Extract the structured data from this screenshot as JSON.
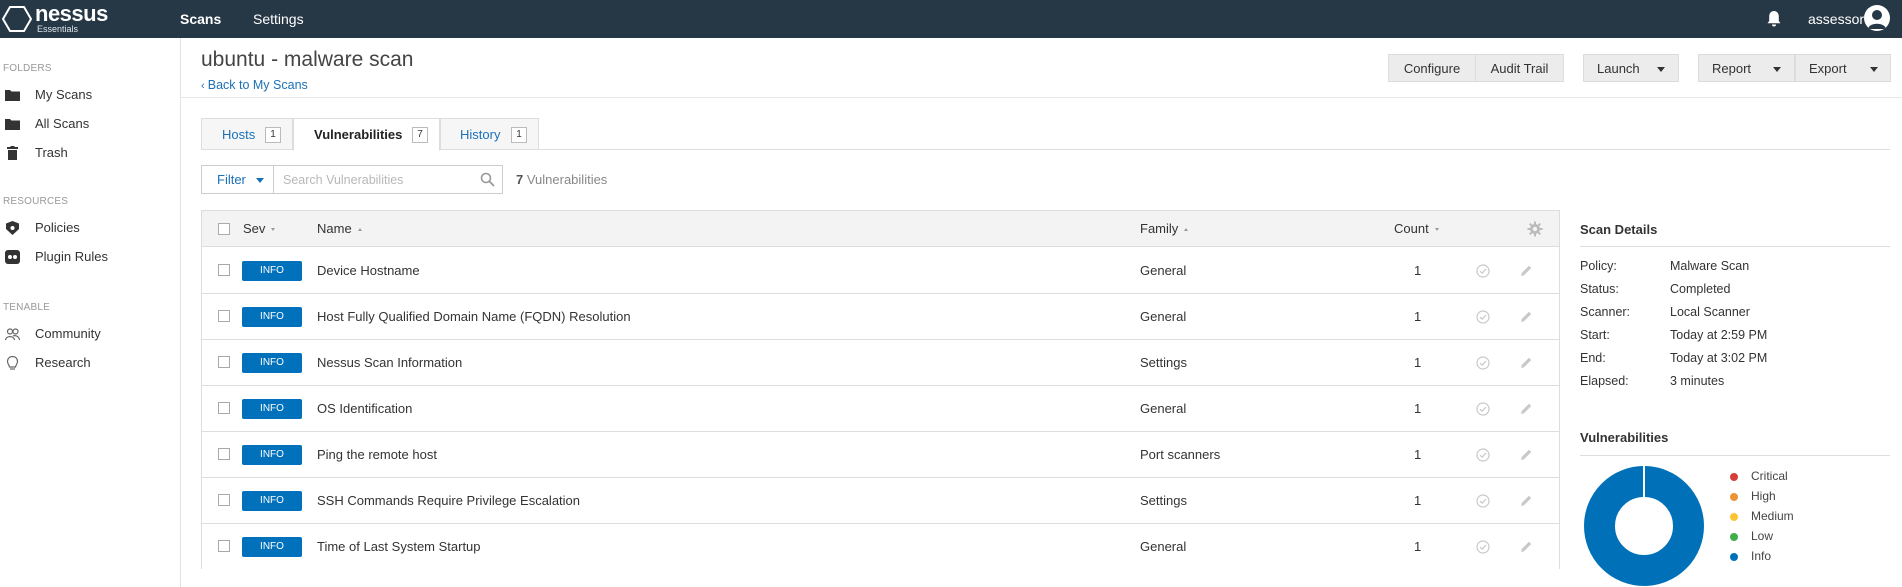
{
  "topbar": {
    "brand": "nessus",
    "edition": "Essentials",
    "nav": [
      {
        "label": "Scans"
      },
      {
        "label": "Settings"
      }
    ],
    "username": "assessor"
  },
  "sidebar": {
    "sections": [
      {
        "heading": "FOLDERS",
        "items": [
          {
            "label": "My Scans",
            "icon": "folder-icon"
          },
          {
            "label": "All Scans",
            "icon": "folder-icon"
          },
          {
            "label": "Trash",
            "icon": "trash-icon"
          }
        ]
      },
      {
        "heading": "RESOURCES",
        "items": [
          {
            "label": "Policies",
            "icon": "policy-shield-icon"
          },
          {
            "label": "Plugin Rules",
            "icon": "plugin-rules-icon"
          }
        ]
      },
      {
        "heading": "TENABLE",
        "items": [
          {
            "label": "Community",
            "icon": "community-icon"
          },
          {
            "label": "Research",
            "icon": "research-icon"
          }
        ]
      }
    ]
  },
  "header": {
    "title": "ubuntu - malware scan",
    "back_link": "Back to My Scans",
    "buttons": {
      "configure": "Configure",
      "audit_trail": "Audit Trail",
      "launch": "Launch",
      "report": "Report",
      "export": "Export"
    }
  },
  "tabs": [
    {
      "label": "Hosts",
      "count": "1"
    },
    {
      "label": "Vulnerabilities",
      "count": "7"
    },
    {
      "label": "History",
      "count": "1"
    }
  ],
  "filter": {
    "label": "Filter",
    "placeholder": "Search Vulnerabilities",
    "count_number": "7",
    "count_label": "Vulnerabilities"
  },
  "table": {
    "columns": {
      "sev": "Sev",
      "name": "Name",
      "family": "Family",
      "count": "Count"
    },
    "rows": [
      {
        "sev": "INFO",
        "name": "Device Hostname",
        "family": "General",
        "count": "1"
      },
      {
        "sev": "INFO",
        "name": "Host Fully Qualified Domain Name (FQDN) Resolution",
        "family": "General",
        "count": "1"
      },
      {
        "sev": "INFO",
        "name": "Nessus Scan Information",
        "family": "Settings",
        "count": "1"
      },
      {
        "sev": "INFO",
        "name": "OS Identification",
        "family": "General",
        "count": "1"
      },
      {
        "sev": "INFO",
        "name": "Ping the remote host",
        "family": "Port scanners",
        "count": "1"
      },
      {
        "sev": "INFO",
        "name": "SSH Commands Require Privilege Escalation",
        "family": "Settings",
        "count": "1"
      },
      {
        "sev": "INFO",
        "name": "Time of Last System Startup",
        "family": "General",
        "count": "1"
      }
    ]
  },
  "scan_details": {
    "title": "Scan Details",
    "items": [
      {
        "label": "Policy:",
        "value": "Malware Scan"
      },
      {
        "label": "Status:",
        "value": "Completed"
      },
      {
        "label": "Scanner:",
        "value": "Local Scanner"
      },
      {
        "label": "Start:",
        "value": "Today at 2:59 PM"
      },
      {
        "label": "End:",
        "value": "Today at 3:02 PM"
      },
      {
        "label": "Elapsed:",
        "value": "3 minutes"
      }
    ]
  },
  "vulnerabilities_panel": {
    "title": "Vulnerabilities",
    "legend": [
      {
        "label": "Critical",
        "color": "#d43f3a",
        "share": 0
      },
      {
        "label": "High",
        "color": "#ee9336",
        "share": 0
      },
      {
        "label": "Medium",
        "color": "#fdc431",
        "share": 0
      },
      {
        "label": "Low",
        "color": "#3fae49",
        "share": 0
      },
      {
        "label": "Info",
        "color": "#0071b9",
        "share": 1
      }
    ]
  },
  "colors": {
    "topbar": "#263746",
    "link": "#1b71b8",
    "info_badge": "#0071ba"
  }
}
